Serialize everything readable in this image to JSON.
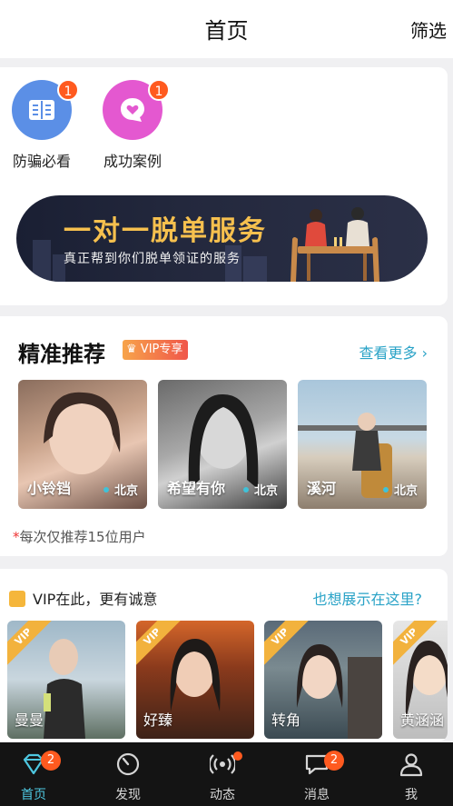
{
  "header": {
    "title": "首页",
    "filter_label": "筛选"
  },
  "quick_links": [
    {
      "label": "防骗必看",
      "badge": "1",
      "icon": "book-icon",
      "color": "#5b8fe6"
    },
    {
      "label": "成功案例",
      "badge": "1",
      "icon": "heart-chat-icon",
      "color": "#e458d0"
    }
  ],
  "banner": {
    "title": "一对一脱单服务",
    "subtitle": "真正帮到你们脱单领证的服务"
  },
  "recommend": {
    "title": "精准推荐",
    "vip_tag": "VIP专享",
    "more_label": "查看更多",
    "users": [
      {
        "name": "小铃铛",
        "city": "北京"
      },
      {
        "name": "希望有你",
        "city": "北京"
      },
      {
        "name": "溪河",
        "city": "北京"
      }
    ],
    "note": "每次仅推荐15位用户",
    "note_mark": "*"
  },
  "vip_section": {
    "title": "VIP在此，更有诚意",
    "link_label": "也想展示在这里?",
    "ribbon": "VIP",
    "users": [
      {
        "name": "曼曼"
      },
      {
        "name": "好臻"
      },
      {
        "name": "转角"
      },
      {
        "name": "黄涵涵"
      }
    ]
  },
  "tabbar": {
    "tabs": [
      {
        "label": "首页",
        "badge": "2",
        "active": true
      },
      {
        "label": "发现"
      },
      {
        "label": "动态",
        "dot": true
      },
      {
        "label": "消息",
        "badge": "2"
      },
      {
        "label": "我"
      }
    ]
  },
  "colors": {
    "accent": "#4ec7e0",
    "link": "#2aa3c7",
    "badge": "#ff5a1f",
    "gold": "#f6c04e"
  }
}
